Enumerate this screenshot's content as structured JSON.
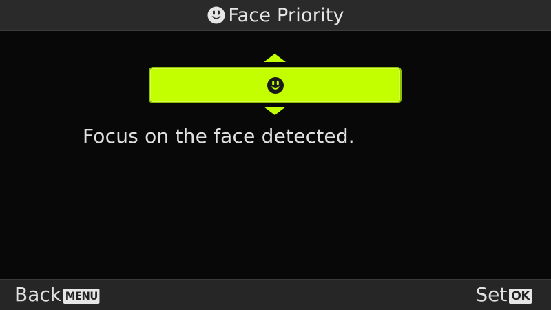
{
  "header": {
    "title": "Face Priority",
    "icon": "face-icon"
  },
  "selector": {
    "selected_option_icon": "face-icon",
    "up_arrow_icon": "triangle-up-icon",
    "down_arrow_icon": "triangle-down-icon",
    "highlight_color": "#c4ff00"
  },
  "description": "Focus on the face detected.",
  "footer": {
    "back_label": "Back",
    "back_key": "MENU",
    "set_label": "Set",
    "set_key": "OK"
  },
  "colors": {
    "background": "#080808",
    "bar_background": "#2a2a2a",
    "text": "#e6e6e6",
    "accent": "#c4ff00"
  }
}
